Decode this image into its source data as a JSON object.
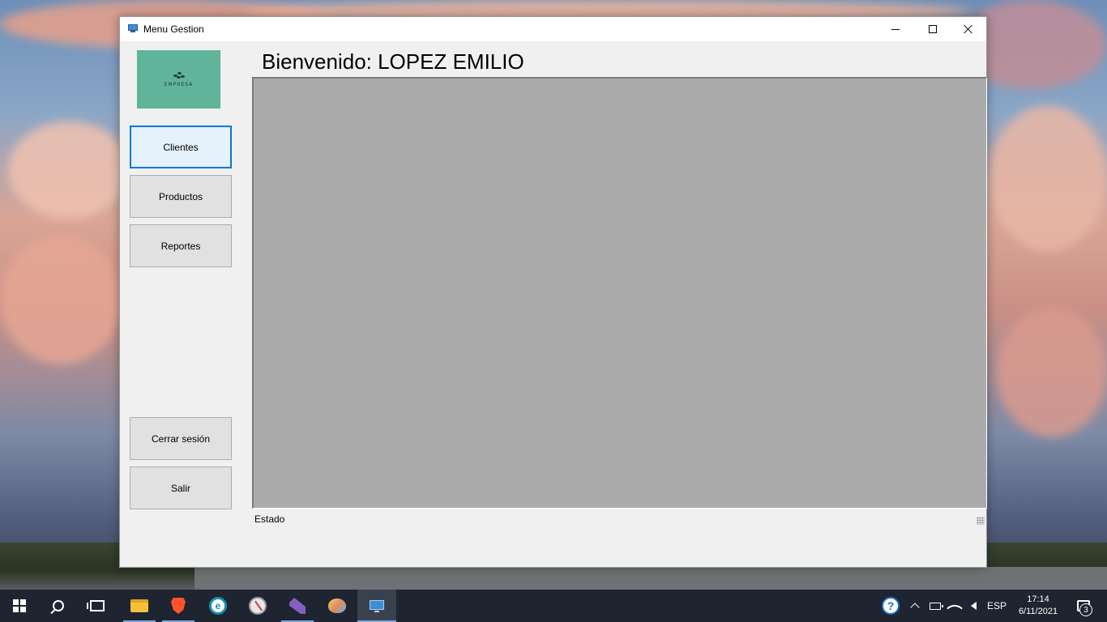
{
  "window": {
    "title": "Menu Gestion",
    "app_icon": "monitor-icon"
  },
  "logo": {
    "text": "EMPRESA",
    "background": "#5fb49a"
  },
  "sidebar": {
    "top_buttons": [
      {
        "label": "Clientes",
        "focused": true
      },
      {
        "label": "Productos"
      },
      {
        "label": "Reportes"
      }
    ],
    "bottom_buttons": [
      {
        "label": "Cerrar sesión"
      },
      {
        "label": "Salir"
      }
    ]
  },
  "main": {
    "welcome": "Bienvenido: LOPEZ EMILIO",
    "panel_color": "#ababab"
  },
  "status_bar": {
    "text": "Estado"
  },
  "taskbar": {
    "apps": [
      {
        "name": "start-icon"
      },
      {
        "name": "search-icon"
      },
      {
        "name": "task-view-icon"
      },
      {
        "name": "file-explorer-icon"
      },
      {
        "name": "brave-browser-icon"
      },
      {
        "name": "browser-e-icon"
      },
      {
        "name": "compass-icon"
      },
      {
        "name": "visual-studio-icon"
      },
      {
        "name": "paint-icon"
      },
      {
        "name": "menu-gestion-app-icon",
        "active": true
      }
    ],
    "tray": {
      "language": "ESP",
      "time": "17:14",
      "date": "6/11/2021",
      "notification_count": "3"
    }
  },
  "colors": {
    "focus_border": "#0078d7",
    "taskbar_bg": "#1e2430"
  }
}
